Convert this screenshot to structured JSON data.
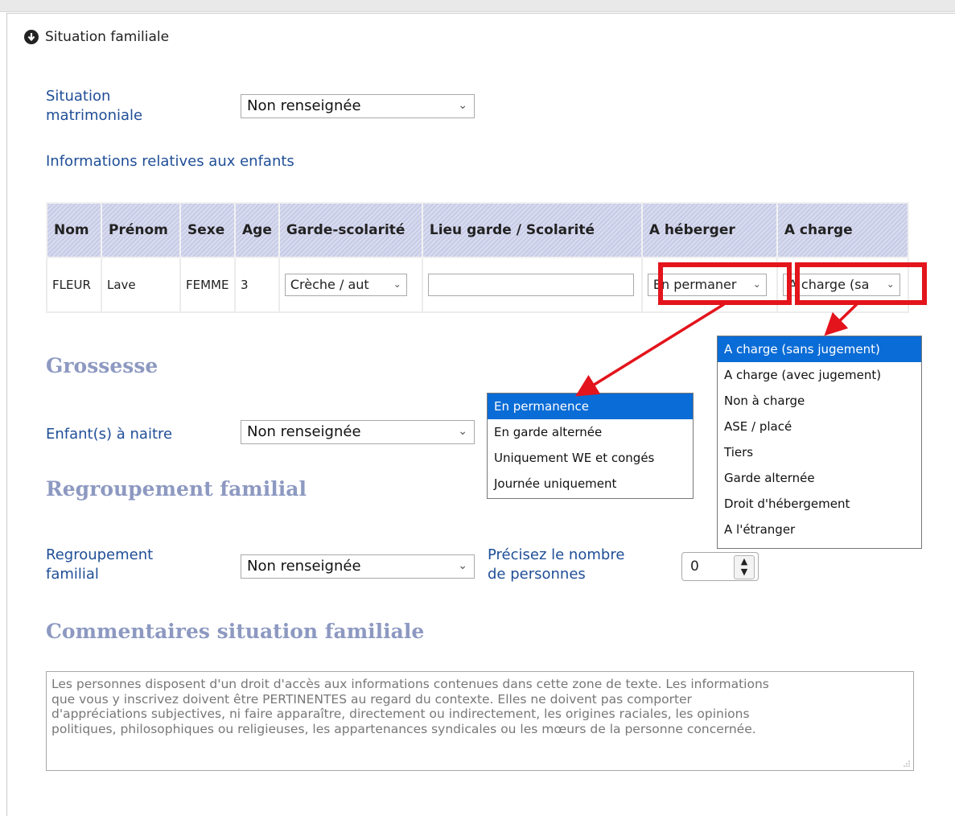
{
  "section": {
    "title": "Situation familiale",
    "collapse_icon": "arrow-down-circle-icon"
  },
  "matrimoniale": {
    "label_line1": "Situation",
    "label_line2": "matrimoniale",
    "value": "Non renseignée"
  },
  "enfants": {
    "title": "Informations relatives aux enfants",
    "headers": [
      "Nom",
      "Prénom",
      "Sexe",
      "Age",
      "Garde-scolarité",
      "Lieu garde / Scolarité",
      "A héberger",
      "A charge"
    ],
    "row": {
      "nom": "FLEUR",
      "prenom": "Lave",
      "sexe": "FEMME",
      "age": "3",
      "garde_scolarite": "Crèche / aut",
      "lieu": "",
      "a_heberger": "En permaner",
      "a_charge": "A charge (sa"
    }
  },
  "grossesse": {
    "title": "Grossesse",
    "label": "Enfant(s) à naitre",
    "value": "Non renseignée"
  },
  "regroupement": {
    "title": "Regroupement familial",
    "label_line1": "Regroupement",
    "label_line2": "familial",
    "value": "Non renseignée",
    "nombre_label_line1": "Précisez le nombre",
    "nombre_label_line2": "de personnes",
    "nombre_value": "0"
  },
  "commentaires": {
    "title": "Commentaires situation familiale",
    "placeholder_lines": [
      "Les personnes disposent d'un droit d'accès aux informations contenues dans cette zone de texte. Les informations",
      "que vous y inscrivez doivent être PERTINENTES au regard du contexte. Elles ne doivent pas comporter",
      "d'appréciations subjectives, ni faire apparaître, directement ou indirectement, les origines raciales, les opinions",
      "politiques, philosophiques ou religieuses, les appartenances syndicales ou les mœurs de la personne concernée."
    ]
  },
  "dropdown_heberger": {
    "options": [
      "En permanence",
      "En garde alternée",
      "Uniquement WE et congés",
      "Journée uniquement"
    ],
    "selected": "En permanence"
  },
  "dropdown_charge": {
    "options": [
      "A charge (sans jugement)",
      "A charge (avec jugement)",
      "Non à charge",
      "ASE / placé",
      "Tiers",
      "Garde alternée",
      "Droit d'hébergement",
      "A l'étranger"
    ],
    "selected": "A charge (sans jugement)"
  },
  "colors": {
    "label_blue": "#1f4e97",
    "heading_gray_blue": "#8d99c1",
    "highlight_red": "#e3141c",
    "selection_blue": "#0a6cd6"
  }
}
